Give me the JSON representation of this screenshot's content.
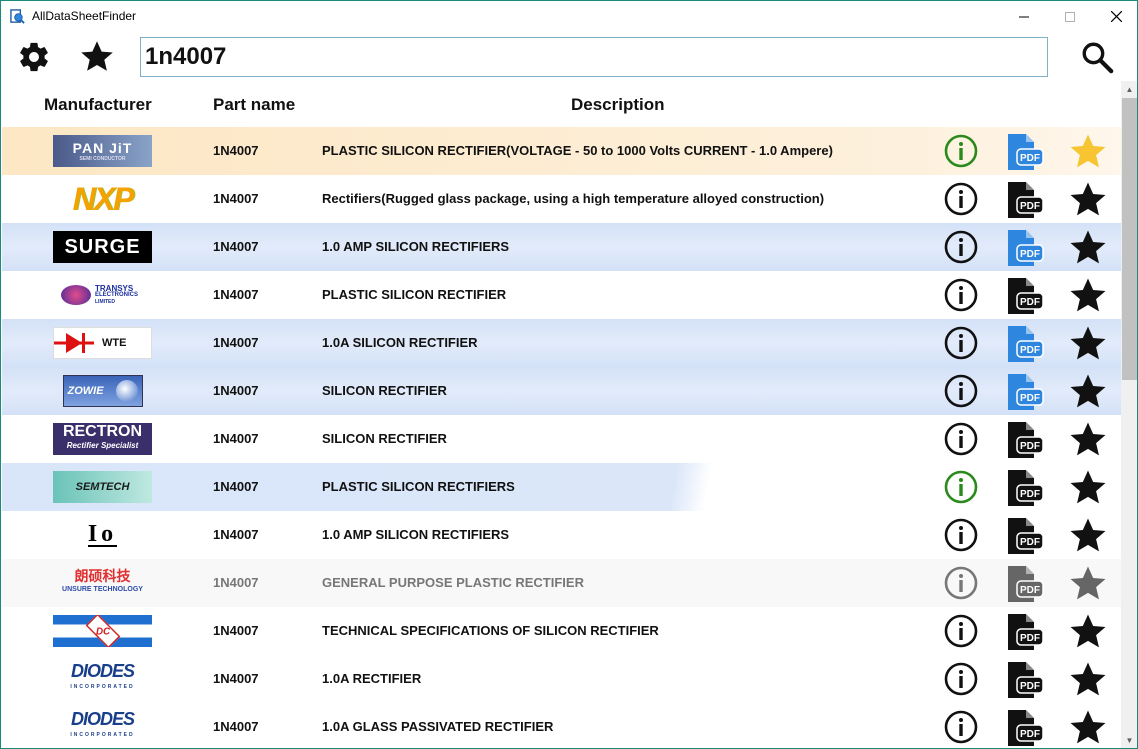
{
  "window": {
    "title": "AllDataSheetFinder"
  },
  "toolbar": {
    "search_value": "1n4007"
  },
  "columns": {
    "manufacturer": "Manufacturer",
    "part_name": "Part name",
    "description": "Description"
  },
  "colors": {
    "info_green": "#2a8a1c",
    "pdf_blue": "#2f86de",
    "favorite_gold": "#f7c531",
    "selected_row": "#fde9c9",
    "highlight_row": "#dbe7f9"
  },
  "logos": {
    "panjit": {
      "text": "PAN JiT",
      "sub": "SEMI CONDUCTOR"
    },
    "nxp": {
      "text": "NXP"
    },
    "surge": {
      "text": "SURGE"
    },
    "transys": {
      "text": "TRANSYS",
      "sub": "ELECTRONICS",
      "sub2": "LIMITED"
    },
    "wte": {
      "text": "WTE"
    },
    "zowie": {
      "text": "ZOWIE"
    },
    "rectron": {
      "text": "RECTRON",
      "sub": "Rectifier Specialist"
    },
    "semtech": {
      "text": "SEMTECH"
    },
    "io": {
      "text": "Io"
    },
    "lunsure": {
      "text": "朗硕科技",
      "sub": "UNSURE TECHNOLOGY"
    },
    "dc": {
      "text": "DC"
    },
    "diodes": {
      "text": "DIODES",
      "sub": "INCORPORATED"
    },
    "pdf_label": "PDF"
  },
  "rows": [
    {
      "logo": "panjit",
      "part": "1N4007",
      "description": "PLASTIC SILICON RECTIFIER(VOLTAGE - 50 to 1000 Volts CURRENT - 1.0 Ampere)",
      "info_status": "green",
      "pdf_status": "blue",
      "favorite": true,
      "row_style": "selected",
      "dim": false
    },
    {
      "logo": "nxp",
      "part": "1N4007",
      "description": "Rectifiers(Rugged glass package, using a high temperature alloyed construction)",
      "info_status": "black",
      "pdf_status": "black",
      "favorite": false,
      "row_style": "plain",
      "dim": false
    },
    {
      "logo": "surge",
      "part": "1N4007",
      "description": "1.0 AMP SILICON RECTIFIERS",
      "info_status": "black",
      "pdf_status": "blue",
      "favorite": false,
      "row_style": "blue",
      "dim": false
    },
    {
      "logo": "transys",
      "part": "1N4007",
      "description": "PLASTIC SILICON RECTIFIER",
      "info_status": "black",
      "pdf_status": "black",
      "favorite": false,
      "row_style": "plain",
      "dim": false
    },
    {
      "logo": "wte",
      "part": "1N4007",
      "description": "1.0A SILICON RECTIFIER",
      "info_status": "black",
      "pdf_status": "blue",
      "favorite": false,
      "row_style": "blue",
      "dim": false
    },
    {
      "logo": "zowie",
      "part": "1N4007",
      "description": "SILICON RECTIFIER",
      "info_status": "black",
      "pdf_status": "blue",
      "favorite": false,
      "row_style": "blue",
      "dim": false
    },
    {
      "logo": "rectron",
      "part": "1N4007",
      "description": "SILICON RECTIFIER",
      "info_status": "black",
      "pdf_status": "black",
      "favorite": false,
      "row_style": "plain",
      "dim": false
    },
    {
      "logo": "semtech",
      "part": "1N4007",
      "description": "PLASTIC SILICON RECTIFIERS",
      "info_status": "green",
      "pdf_status": "black",
      "favorite": false,
      "row_style": "fade",
      "dim": false
    },
    {
      "logo": "io",
      "part": "1N4007",
      "description": "1.0 AMP SILICON RECTIFIERS",
      "info_status": "black",
      "pdf_status": "black",
      "favorite": false,
      "row_style": "plain",
      "dim": false
    },
    {
      "logo": "lunsure",
      "part": "1N4007",
      "description": "GENERAL PURPOSE PLASTIC RECTIFIER",
      "info_status": "gray",
      "pdf_status": "gray",
      "favorite": false,
      "row_style": "gray",
      "dim": true
    },
    {
      "logo": "dc",
      "part": "1N4007",
      "description": "TECHNICAL SPECIFICATIONS OF SILICON RECTIFIER",
      "info_status": "black",
      "pdf_status": "black",
      "favorite": false,
      "row_style": "plain",
      "dim": false
    },
    {
      "logo": "diodes",
      "part": "1N4007",
      "description": "1.0A RECTIFIER",
      "info_status": "black",
      "pdf_status": "black",
      "favorite": false,
      "row_style": "plain",
      "dim": false
    },
    {
      "logo": "diodes",
      "part": "1N4007",
      "description": "1.0A GLASS PASSIVATED RECTIFIER",
      "info_status": "black",
      "pdf_status": "black",
      "favorite": false,
      "row_style": "plain",
      "dim": false
    }
  ]
}
